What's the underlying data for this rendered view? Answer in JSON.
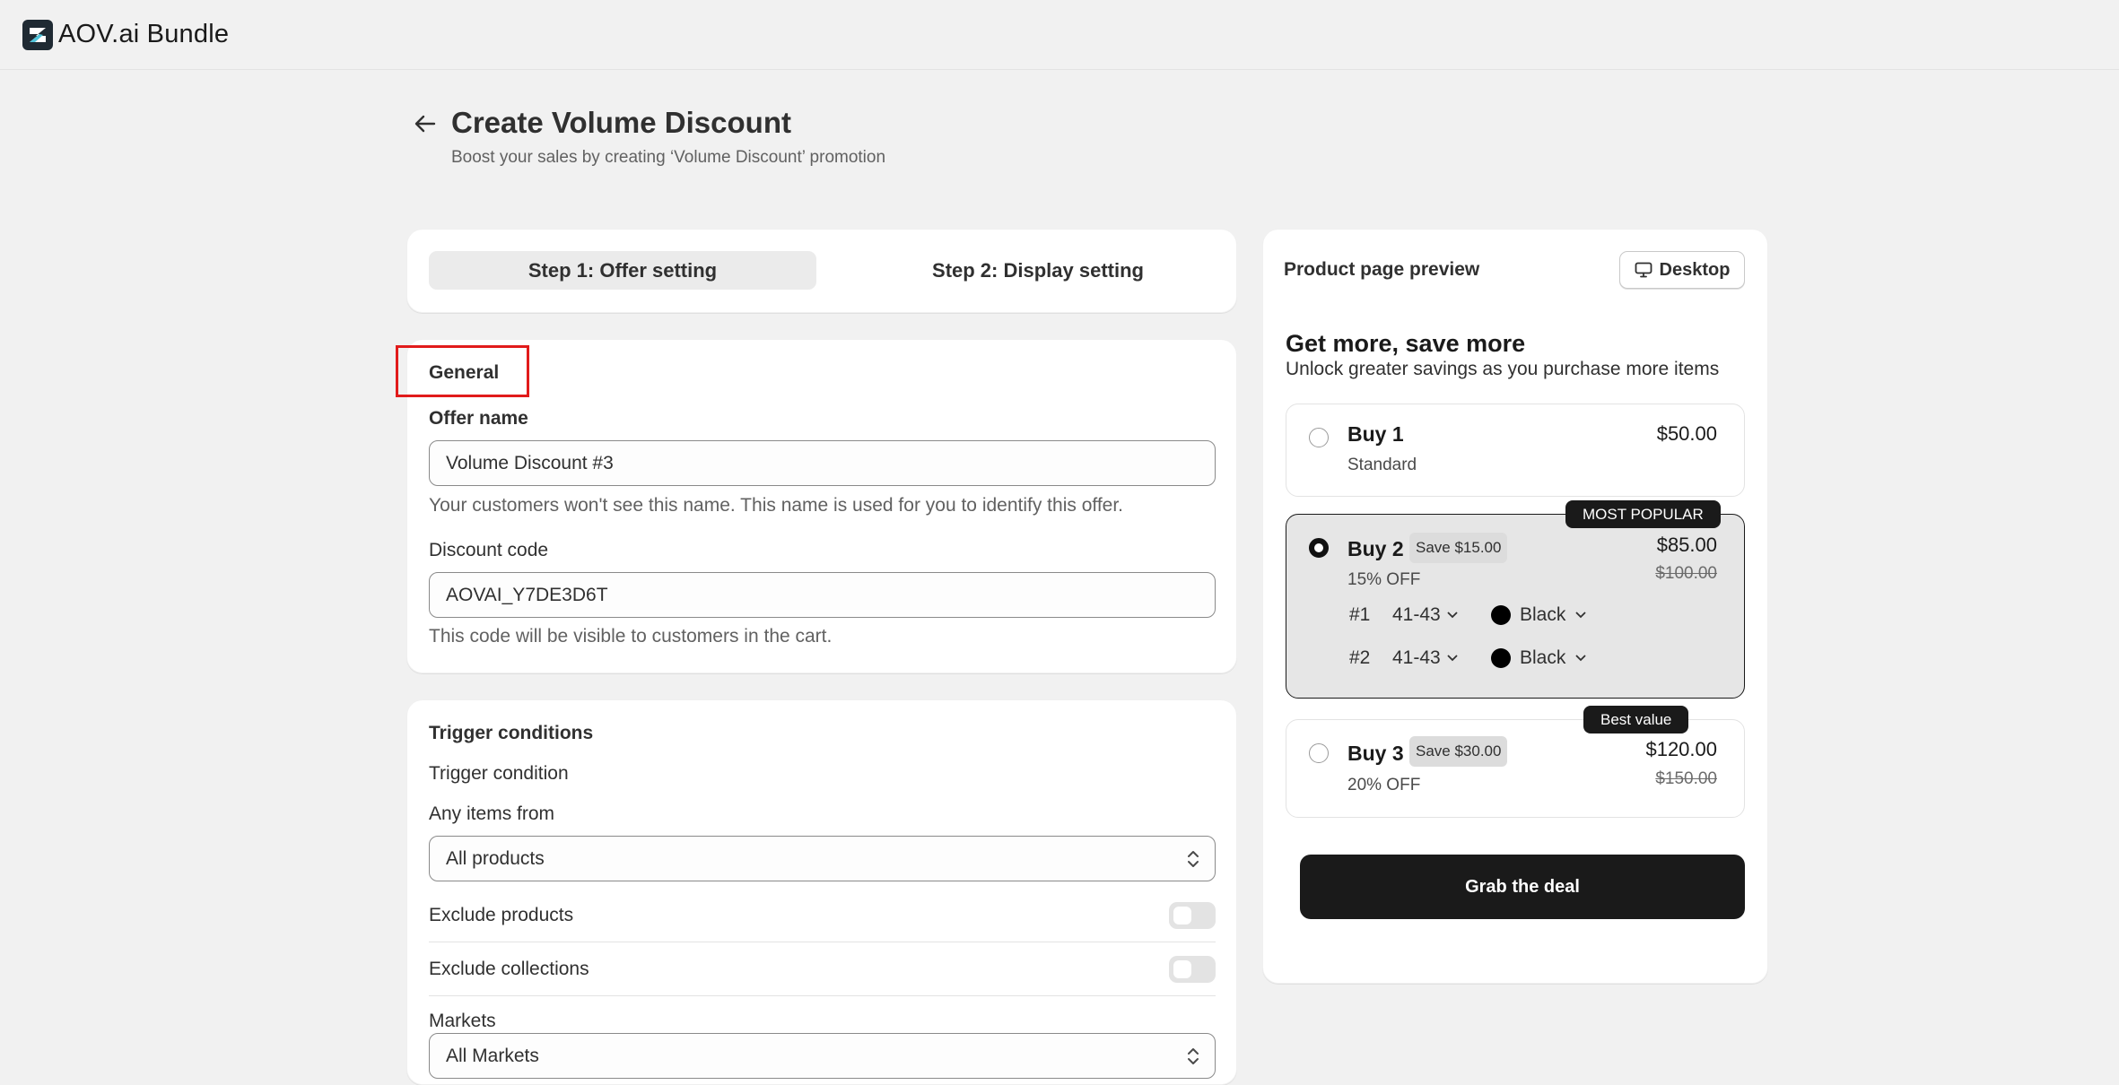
{
  "app": {
    "name": "AOV.ai Bundle"
  },
  "header": {
    "title": "Create Volume Discount",
    "subtitle": "Boost your sales by creating ‘Volume Discount’ promotion"
  },
  "steps": [
    {
      "label": "Step 1: Offer setting",
      "active": true
    },
    {
      "label": "Step 2: Display setting",
      "active": false
    }
  ],
  "general": {
    "title": "General",
    "offer_name_label": "Offer name",
    "offer_name_value": "Volume Discount #3",
    "offer_name_help": "Your customers won't see this name. This name is used for you to identify this offer.",
    "discount_code_label": "Discount code",
    "discount_code_value": "AOVAI_Y7DE3D6T",
    "discount_code_help": "This code will be visible to customers in the cart."
  },
  "trigger": {
    "title": "Trigger conditions",
    "condition_label": "Trigger condition",
    "items_from_label": "Any items from",
    "items_from_value": "All products",
    "exclude_products_label": "Exclude products",
    "exclude_products_on": false,
    "exclude_collections_label": "Exclude collections",
    "exclude_collections_on": false,
    "markets_label": "Markets",
    "markets_value": "All Markets"
  },
  "preview": {
    "title": "Product page preview",
    "device_label": "Desktop",
    "heading": "Get more, save more",
    "subheading": "Unlock greater savings as you purchase more items",
    "tiers": [
      {
        "name": "Buy 1",
        "sub": "Standard",
        "price": "$50.00",
        "selected": false
      },
      {
        "name": "Buy 2",
        "badge": "Save $15.00",
        "sub": "15% OFF",
        "price": "$85.00",
        "old_price": "$100.00",
        "tag": "MOST POPULAR",
        "selected": true,
        "variants": [
          {
            "index": "#1",
            "size": "41-43",
            "color": "Black"
          },
          {
            "index": "#2",
            "size": "41-43",
            "color": "Black"
          }
        ]
      },
      {
        "name": "Buy 3",
        "badge": "Save $30.00",
        "sub": "20% OFF",
        "price": "$120.00",
        "old_price": "$150.00",
        "tag": "Best value",
        "selected": false
      }
    ],
    "cta": "Grab the deal"
  },
  "colors": {
    "accent_dark": "#1a1a1a",
    "highlight": "#e11b1b",
    "background": "#f1f1f1"
  }
}
